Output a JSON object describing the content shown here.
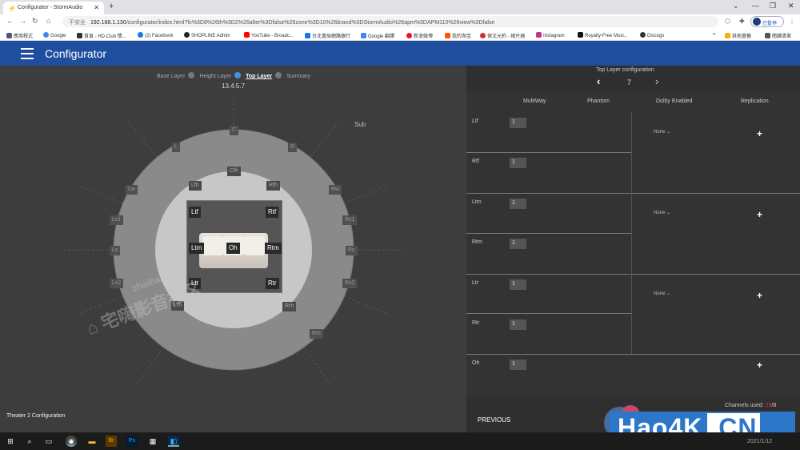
{
  "browser": {
    "tab_title": "Configurator - StormAudio",
    "tab_close": "✕",
    "new_tab": "+",
    "window_controls": [
      "⌄",
      "—",
      "❐",
      "✕"
    ],
    "url_security": "不安全",
    "url_host": "192.168.1.130",
    "url_path": "/configurator/index.html?fc%3D8%26th%3D2%26alter%3Dfalse%26zone%3D10%26brand%3DStormAudio%26apm%3DAPM110%26view%3Dfalse",
    "profile_label": "已暫停",
    "bookmarks": [
      "應用程式",
      "Google",
      "首頁 - HD.Club 情...",
      "(2) Facebook",
      "SHOPLINE Admin",
      "YouTube - Broadc...",
      "台北書局網路銀行",
      "Google 翻譯",
      "新浪微博",
      "我的淘宝",
      "保文元約 - 帳片搞",
      "Instagram",
      "Royalty-Free Musi...",
      "Discogs",
      "»",
      "其他書籤",
      "閱讀清單"
    ]
  },
  "app": {
    "title": "Configurator"
  },
  "layer_nav": {
    "items": [
      "Base Layer",
      "Height Layer",
      "Top Layer",
      "Summary"
    ],
    "active": "Top Layer"
  },
  "version": "13.4.5.7",
  "speakers": {
    "outer": [
      "C",
      "L",
      "R",
      "Lw",
      "Rw",
      "Ls1",
      "Rs1",
      "Ls",
      "Rs",
      "Ls2",
      "Rs2",
      "Sub"
    ],
    "inner": [
      "Cfh",
      "Lfh",
      "Rfh",
      "Lrh",
      "Rrh",
      "Rrs"
    ],
    "selected": [
      "Ltf",
      "Rtf",
      "Ltm",
      "Oh",
      "Rtm",
      "Ltr",
      "Rtr"
    ]
  },
  "theater_label": "Theater 2 Configuration",
  "watermark": {
    "main": "宅嗨影音社区",
    "url": "zhaihai.com"
  },
  "config": {
    "title": "Top Layer configuration",
    "prev_icon": "‹",
    "next_icon": "›",
    "count": "7",
    "headers": [
      "MultiWay",
      "Phantom",
      "Dolby Enabled",
      "Replication"
    ],
    "rows": [
      {
        "label": "Ltf",
        "value": "1"
      },
      {
        "label": "Rtf",
        "value": "1"
      },
      {
        "label": "Ltm",
        "value": "1"
      },
      {
        "label": "Rtm",
        "value": "1"
      },
      {
        "label": "Ltr",
        "value": "1"
      },
      {
        "label": "Rtr",
        "value": "1"
      },
      {
        "label": "Oh",
        "value": "1"
      }
    ],
    "dolby_values": [
      "None ⌄",
      "None ⌄",
      "None ⌄"
    ],
    "plus": "+",
    "channels_used_label": "Channels used:",
    "channels_used_value": "26",
    "channels_used_total": "/8"
  },
  "buttons": {
    "previous": "PREVIOUS"
  },
  "badge": {
    "text": "Hao4K",
    "suffix": ".CN"
  },
  "taskbar": {
    "clock": "2021/1/12"
  }
}
